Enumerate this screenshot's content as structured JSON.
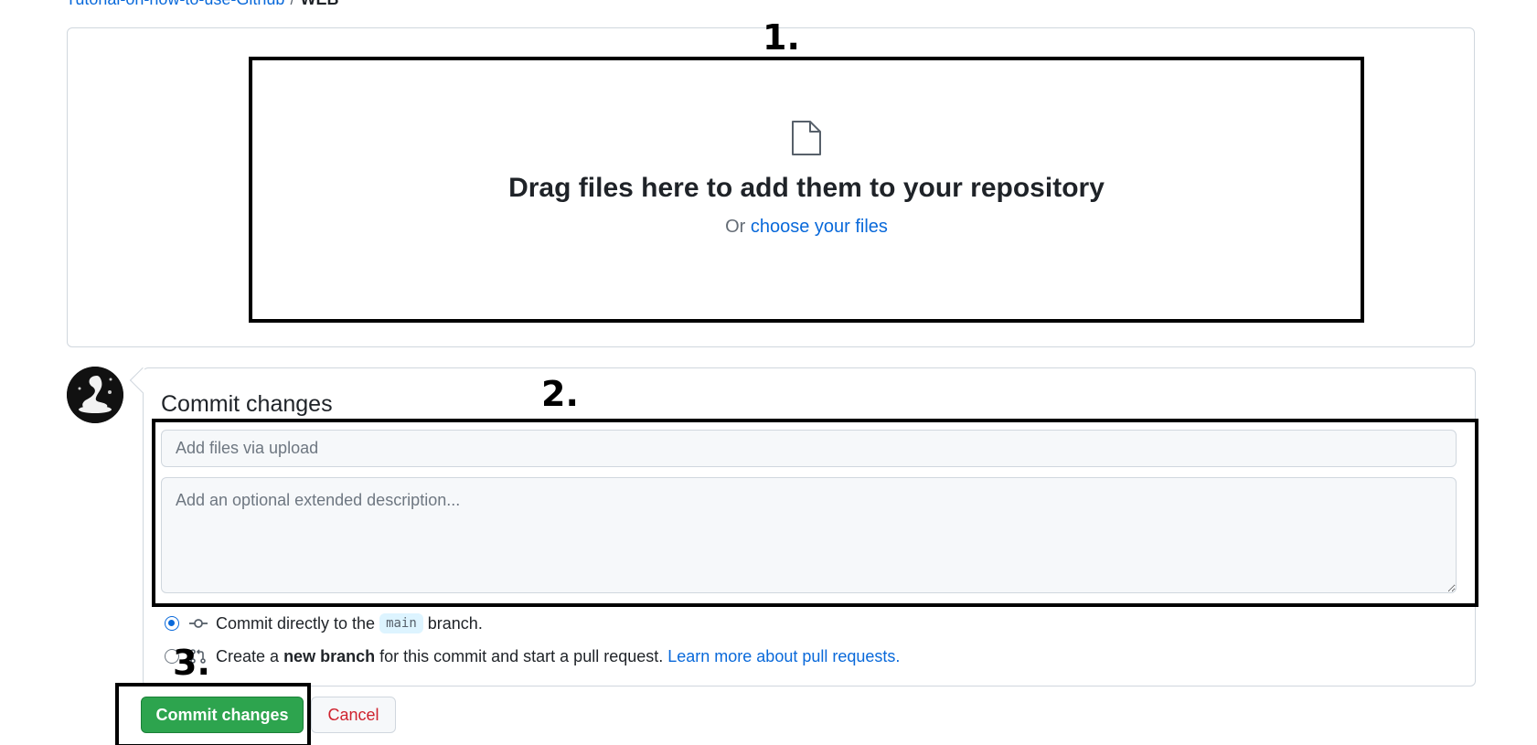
{
  "breadcrumb": {
    "repo": "Tutorial-on-how-to-use-Github",
    "separator": "/",
    "folder": "WEB"
  },
  "upload": {
    "icon": "file-icon",
    "title": "Drag files here to add them to your repository",
    "or_text": "Or",
    "choose_link": "choose your files"
  },
  "commit": {
    "heading": "Commit changes",
    "summary_placeholder": "Add files via upload",
    "description_placeholder": "Add an optional extended description...",
    "direct": {
      "prefix": "Commit directly to the",
      "branch": "main",
      "suffix": "branch.",
      "checked": true
    },
    "new_branch": {
      "prefix": "Create a",
      "bold": "new branch",
      "suffix": "for this commit and start a pull request.",
      "link": "Learn more about pull requests.",
      "checked": false
    },
    "commit_button": "Commit changes",
    "cancel_button": "Cancel"
  },
  "annotations": {
    "step1": "1.",
    "step2": "2.",
    "step3": "3."
  },
  "colors": {
    "link": "#0969da",
    "primary_button": "#2da44e",
    "danger_text": "#cf222e",
    "border": "#d0d7de",
    "annotation": "#000000"
  }
}
